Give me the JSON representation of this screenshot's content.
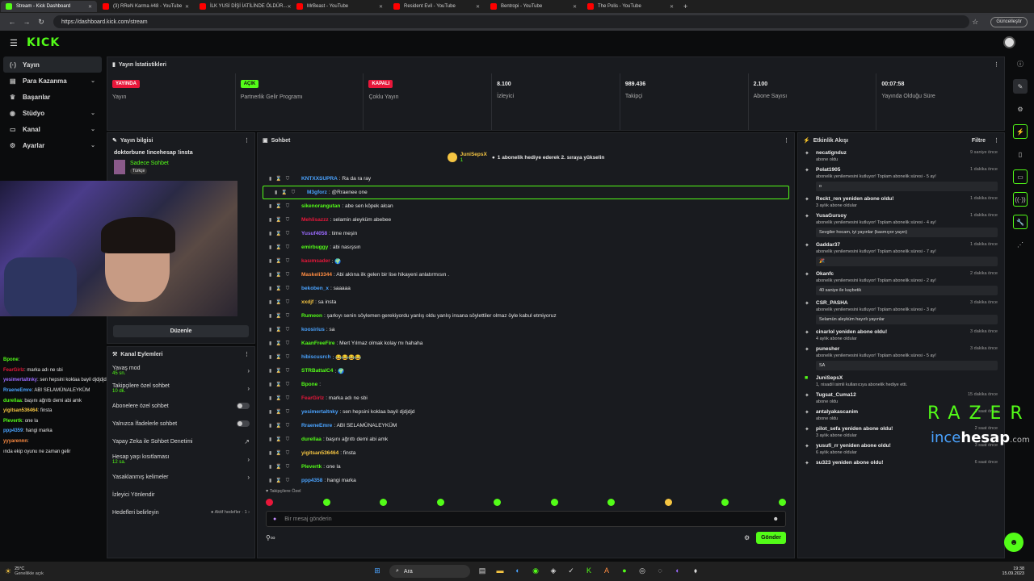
{
  "browser": {
    "tabs": [
      {
        "title": "Stream - Kick Dashboard",
        "active": true,
        "color": "#53fc18"
      },
      {
        "title": "(3) RReN Karma #48 - YouTube",
        "color": "#ff0000"
      },
      {
        "title": "İLK YUSİ DİŞİ İATİLİNDE ÖLDÜR...",
        "color": "#ff0000"
      },
      {
        "title": "MrBeast - YouTube",
        "color": "#ff0000"
      },
      {
        "title": "Resident Evil - YouTube",
        "color": "#ff0000"
      },
      {
        "title": "Bentropi - YouTube",
        "color": "#ff0000"
      },
      {
        "title": "The Polis - YouTube",
        "color": "#ff0000"
      }
    ],
    "new_tab": "+",
    "url": "https://dashboard.kick.com/stream",
    "update_label": "Güncelleştir"
  },
  "app": {
    "logo": "KICK"
  },
  "sidebar": {
    "items": [
      {
        "label": "Yayın",
        "icon": "(·)",
        "chev": ""
      },
      {
        "label": "Para Kazanma",
        "icon": "▤",
        "chev": "⌄"
      },
      {
        "label": "Başarılar",
        "icon": "♛",
        "chev": ""
      },
      {
        "label": "Stüdyo",
        "icon": "◉",
        "chev": "⌄"
      },
      {
        "label": "Kanal",
        "icon": "▭",
        "chev": "⌄"
      },
      {
        "label": "Ayarlar",
        "icon": "⚙",
        "chev": "⌄"
      }
    ]
  },
  "stats": {
    "title": "Yayın İstatistikleri",
    "items": [
      {
        "badge": "YAYINDA",
        "badge_color": "#e8173a",
        "label": "Yayın"
      },
      {
        "badge": "AÇIK",
        "badge_color": "#53fc18",
        "label": "Partnerlik Gelir Programı"
      },
      {
        "badge": "KAPALI",
        "badge_color": "#e8173a",
        "label": "Çoklu Yayın"
      },
      {
        "value": "8.100",
        "label": "İzleyici"
      },
      {
        "value": "989.436",
        "label": "Takipçi"
      },
      {
        "value": "2.100",
        "label": "Abone Sayısı"
      },
      {
        "value": "00:07:58",
        "label": "Yayında Olduğu Süre"
      }
    ]
  },
  "info": {
    "title": "Yayın bilgisi",
    "stream_title": "doktorbune !incehesap !insta",
    "category": "Sadece Sohbet",
    "tag": "Türkçe",
    "edit_label": "Düzenle"
  },
  "overlay_chat": [
    {
      "user": "Bpone",
      "text": ":",
      "color": "#53fc18"
    },
    {
      "user": "FearGirlz",
      "text": ": marka adı ne sbi",
      "color": "#e8173a"
    },
    {
      "user": "yesimertaltnky",
      "text": ": sen hepsini koklaa bayil djdjdjd",
      "color": "#9b6bff"
    },
    {
      "user": "RraeneEmre",
      "text": ": ABI SELAMÜNALEYKÜM",
      "color": "#4aa3ff"
    },
    {
      "user": "durellaa",
      "text": ": başını ağrıttı demi abi amk",
      "color": "#53fc18"
    },
    {
      "user": "yigitsan536464",
      "text": ": finsta",
      "color": "#f5c542"
    },
    {
      "user": "Plevertk",
      "text": ": one la",
      "color": "#53fc18"
    },
    {
      "user": "ppp4359",
      "text": ": hangi marka",
      "color": "#4aa3ff"
    },
    {
      "user": "yyyarennn",
      "text": ":",
      "color": "#ff8c42"
    },
    {
      "user": "",
      "text": "ında ekip oyunu ne zaman gelir",
      "color": "#ddd"
    }
  ],
  "actions": {
    "title": "Kanal Eylemleri",
    "items": [
      {
        "label": "Yavaş mod",
        "sub": "45 sn.",
        "right": "›"
      },
      {
        "label": "Takipçilere özel sohbet",
        "sub": "10 dk.",
        "right": "›"
      },
      {
        "label": "Abonelere özel sohbet",
        "sub": "",
        "right": "toggle"
      },
      {
        "label": "Yalnızca İfadelerle sohbet",
        "sub": "",
        "right": "toggle"
      },
      {
        "label": "Yapay Zeka ile Sohbet Denetimi",
        "sub": "",
        "right": "↗"
      },
      {
        "label": "Hesap yaşı kısıtlaması",
        "sub": "12 sa.",
        "right": "›"
      },
      {
        "label": "Yasaklanmış kelimeler",
        "sub": "",
        "right": "›"
      },
      {
        "label": "İzleyici Yönlendir",
        "sub": "",
        "right": ""
      },
      {
        "label": "Hedefleri belirleyin",
        "sub": "",
        "right": "● Aktif hedefler · 1 ›"
      }
    ]
  },
  "chat": {
    "title": "Sohbet",
    "pinned_user": "JuniSepsX",
    "pinned_count": "1",
    "pinned_text": "1 abonelik hediye ederek 2. sıraya yükselin",
    "messages": [
      {
        "user": "KNTXXSUPRA",
        "text": ": Ra da ra ray",
        "color": "#4aa3ff"
      },
      {
        "user": "M3gforz",
        "text": ": @Rraenee one",
        "color": "#4aa3ff",
        "hl": true
      },
      {
        "user": "sikenorangutan",
        "text": ": abe sen köpek alcan",
        "color": "#53fc18"
      },
      {
        "user": "Mehlisazzz",
        "text": ": selamin aleyküm abebee",
        "color": "#e8173a"
      },
      {
        "user": "Yusuf4058",
        "text": ": time meşin",
        "color": "#9b6bff"
      },
      {
        "user": "emirbuggy",
        "text": ": abi nasışsın",
        "color": "#53fc18"
      },
      {
        "user": "kasımsader",
        "text": ": 🌍",
        "color": "#e8173a"
      },
      {
        "user": "Maskeli3344",
        "text": ": Abi aklına ilk gelen bir lise hikayeni anlatırmısın .",
        "color": "#ff8c42"
      },
      {
        "user": "bekoben_x",
        "text": ": saaaaa",
        "color": "#4aa3ff"
      },
      {
        "user": "xxdjf",
        "text": ": sa insta",
        "color": "#f5c542"
      },
      {
        "user": "Rumeon",
        "text": ": şarkıyı senin söylemen gerekiyordu yanlış oldu yanlış insana söylettiler olmaz öyle kabul etmiyoruz",
        "color": "#53fc18"
      },
      {
        "user": "koosirius",
        "text": ": sa",
        "color": "#4aa3ff"
      },
      {
        "user": "KaanFreeFire",
        "text": ": Mert Yılmaz olmak kolay mı hahaha",
        "color": "#53fc18"
      },
      {
        "user": "hibiscusrch",
        "text": ": 😂😂😂😂",
        "color": "#4aa3ff"
      },
      {
        "user": "STRBattalC4",
        "text": ": 🌍",
        "color": "#53fc18"
      },
      {
        "user": "Bpone",
        "text": ":",
        "color": "#53fc18"
      },
      {
        "user": "FearGirlz",
        "text": ": marka adı ne sbi",
        "color": "#e8173a"
      },
      {
        "user": "yesimertaltnky",
        "text": ": sen hepsini koklaa bayil djdjdjd",
        "color": "#4aa3ff"
      },
      {
        "user": "RraeneEmre",
        "text": ": ABI SELAMÜNALEYKÜM",
        "color": "#4aa3ff"
      },
      {
        "user": "durellaa",
        "text": ": başını ağrıttı demi abi amk",
        "color": "#53fc18"
      },
      {
        "user": "yigitsan536464",
        "text": ": finsta",
        "color": "#f5c542"
      },
      {
        "user": "Plevertk",
        "text": ": one la",
        "color": "#53fc18"
      },
      {
        "user": "ppp4358",
        "text": ": hangi marka",
        "color": "#4aa3ff"
      }
    ],
    "followers_only": "Takipçilere Özel",
    "input_placeholder": "Bir mesaj gönderin",
    "send_label": "Gönder"
  },
  "activity": {
    "title": "Etkinlik Akışı",
    "filter_label": "Filtre",
    "items": [
      {
        "title": "necatignduz",
        "sub": "abone oldu",
        "time": "9 saniye önce"
      },
      {
        "title": "Polat1905",
        "sub": "abonelik yenilemesini kutluyor! Toplam abonelik süresi - 5 ay!",
        "time": "1 dakika önce",
        "msg": "o"
      },
      {
        "title": "Reckt_ren yeniden abone oldu!",
        "sub": "3 aylık abone oldular",
        "time": "1 dakika önce"
      },
      {
        "title": "YusaGursoy",
        "sub": "abonelik yenilemesini kutluyor! Toplam abonelik süresi - 4 ay!",
        "time": "1 dakika önce",
        "msg": "Sevgiler hocam, iyi yayınlar (kasmıyor yayın)"
      },
      {
        "title": "Gaddar37",
        "sub": "abonelik yenilemesini kutluyor! Toplam abonelik süresi - 7 ay!",
        "time": "1 dakika önce",
        "msg": "🎉"
      },
      {
        "title": "Okanfc",
        "sub": "abonelik yenilemesini kutluyor! Toplam abonelik süresi - 2 ay!",
        "time": "2 dakika önce",
        "msg": "40 saniye ile kaybetik"
      },
      {
        "title": "CSR_PASHA",
        "sub": "abonelik yenilemesini kutluyor! Toplam abonelik süresi - 3 ay!",
        "time": "3 dakika önce",
        "msg": "Selamün aleyküm hayırlı yayınlar"
      },
      {
        "title": "cinarlol yeniden abone oldu!",
        "sub": "4 aylık abone oldular",
        "time": "3 dakika önce"
      },
      {
        "title": "punesher",
        "sub": "abonelik yenilemesini kutluyor! Toplam abonelik süresi - 5 ay!",
        "time": "3 dakika önce",
        "msg": "SA"
      },
      {
        "title": "JuniSepsX",
        "sub": "1, nisadil isimli kullanıcıya abonelik hediye etti.",
        "time": "",
        "gift": true
      },
      {
        "title": "Tugsat_Cuma12",
        "sub": "abone oldu",
        "time": "15 dakika önce"
      },
      {
        "title": "antalyakascanim",
        "sub": "abone oldu",
        "time": "1 saat önce"
      },
      {
        "title": "pilot_sefa yeniden abone oldu!",
        "sub": "3 aylık abone oldular",
        "time": "2 saat önce"
      },
      {
        "title": "yusufi_rr yeniden abone oldu!",
        "sub": "6 aylık abone oldular",
        "time": "3 saat önce"
      },
      {
        "title": "su323 yeniden abone oldu!",
        "sub": "",
        "time": "6 saat önce"
      }
    ]
  },
  "overlay": {
    "razer": "RAZER",
    "ince": "ince",
    "hesap": "hesap",
    "com": ".com"
  },
  "taskbar": {
    "weather_temp": "25°C",
    "weather_text": "Genellikle açık",
    "search": "Ara",
    "time": "19:38",
    "date": "15.09.2023"
  }
}
